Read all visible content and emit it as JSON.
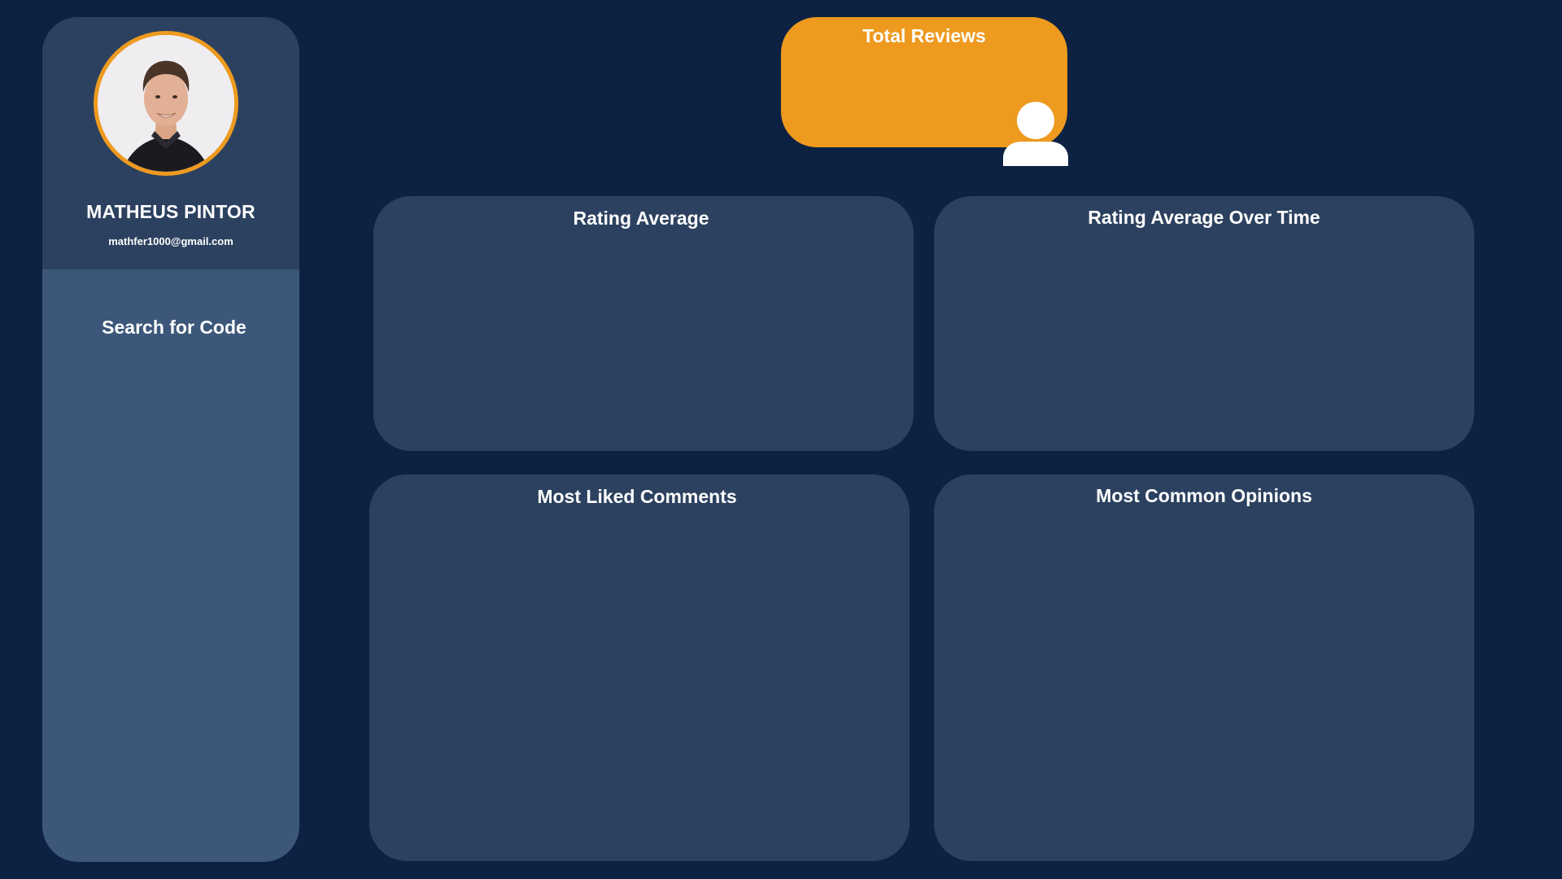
{
  "profile": {
    "name": "MATHEUS PINTOR",
    "email": "mathfer1000@gmail.com",
    "avatar_icon": "user-photo"
  },
  "sidebar": {
    "search_title": "Search for Code"
  },
  "total_reviews": {
    "title": "Total Reviews",
    "icon": "person-icon"
  },
  "panels": [
    {
      "title": "Rating Average"
    },
    {
      "title": "Rating Average Over Time"
    },
    {
      "title": "Most Liked Comments"
    },
    {
      "title": "Most Common Opinions"
    }
  ],
  "colors": {
    "background": "#0d2242",
    "panel": "#2c415f",
    "sidebar_lower": "#3c5779",
    "accent": "#ed9a1f",
    "text": "#ffffff"
  }
}
